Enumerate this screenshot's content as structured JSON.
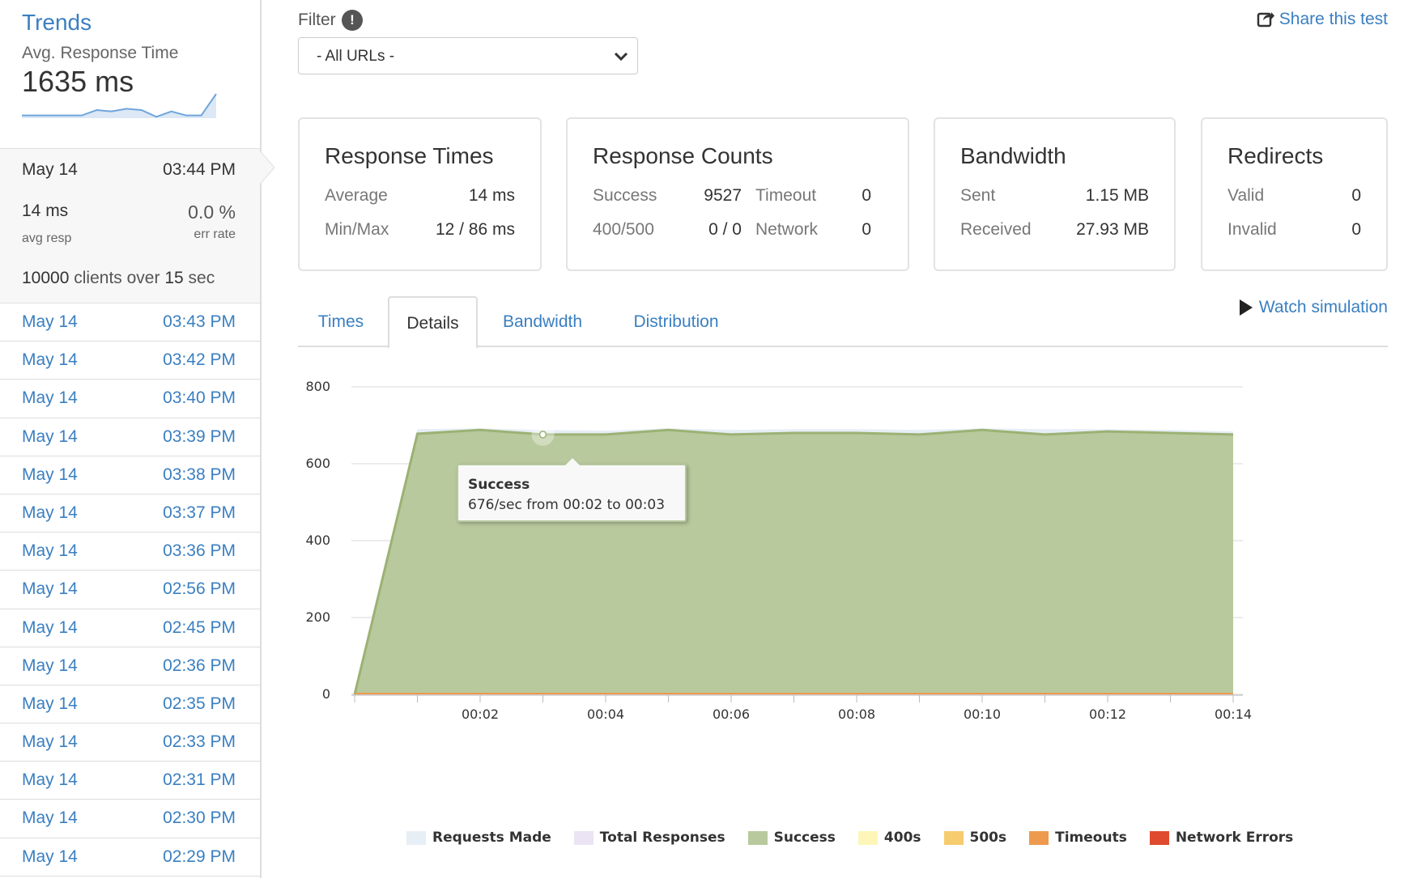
{
  "sidebar": {
    "title": "Trends",
    "metric_label": "Avg. Response Time",
    "metric_value": "1635 ms",
    "sparkline": [
      2,
      2,
      2,
      2,
      2,
      6,
      5,
      7,
      6,
      1,
      5,
      2,
      2,
      18
    ],
    "current": {
      "date": "May 14",
      "time": "03:44 PM",
      "avg_resp": "14 ms",
      "avg_resp_label": "avg resp",
      "err_rate": "0.0 %",
      "err_rate_label": "err rate",
      "clients": "10000",
      "clients_mid": "clients over",
      "duration": "15",
      "duration_unit": "sec"
    },
    "history": [
      {
        "date": "May 14",
        "time": "03:43 PM"
      },
      {
        "date": "May 14",
        "time": "03:42 PM"
      },
      {
        "date": "May 14",
        "time": "03:40 PM"
      },
      {
        "date": "May 14",
        "time": "03:39 PM"
      },
      {
        "date": "May 14",
        "time": "03:38 PM"
      },
      {
        "date": "May 14",
        "time": "03:37 PM"
      },
      {
        "date": "May 14",
        "time": "03:36 PM"
      },
      {
        "date": "May 14",
        "time": "02:56 PM"
      },
      {
        "date": "May 14",
        "time": "02:45 PM"
      },
      {
        "date": "May 14",
        "time": "02:36 PM"
      },
      {
        "date": "May 14",
        "time": "02:35 PM"
      },
      {
        "date": "May 14",
        "time": "02:33 PM"
      },
      {
        "date": "May 14",
        "time": "02:31 PM"
      },
      {
        "date": "May 14",
        "time": "02:30 PM"
      },
      {
        "date": "May 14",
        "time": "02:29 PM"
      }
    ]
  },
  "header": {
    "filter_label": "Filter",
    "filter_info": "!",
    "url_select_value": "- All URLs -",
    "share_label": "Share this test"
  },
  "cards": {
    "response_times": {
      "title": "Response Times",
      "average_label": "Average",
      "average_value": "14 ms",
      "minmax_label": "Min/Max",
      "minmax_value": "12 / 86 ms"
    },
    "response_counts": {
      "title": "Response Counts",
      "success_label": "Success",
      "success_value": "9527",
      "timeout_label": "Timeout",
      "timeout_value": "0",
      "e400_label": "400/500",
      "e400_value": "0 / 0",
      "network_label": "Network",
      "network_value": "0"
    },
    "bandwidth": {
      "title": "Bandwidth",
      "sent_label": "Sent",
      "sent_value": "1.15 MB",
      "received_label": "Received",
      "received_value": "27.93 MB"
    },
    "redirects": {
      "title": "Redirects",
      "valid_label": "Valid",
      "valid_value": "0",
      "invalid_label": "Invalid",
      "invalid_value": "0"
    }
  },
  "tabs": {
    "items": [
      "Times",
      "Details",
      "Bandwidth",
      "Distribution"
    ],
    "active": "Details",
    "watch_label": "Watch simulation"
  },
  "tooltip": {
    "title": "Success",
    "body": "676/sec from 00:02 to 00:03"
  },
  "colors": {
    "link": "#3a7fc1",
    "success": "#b8c99d",
    "success_line": "#9bb274",
    "requests": "#e6eef6",
    "responses": "#ebe4f4",
    "c400": "#fdf6b8",
    "c500": "#f6cc6f",
    "timeouts": "#ee9a4e",
    "network": "#e04a2e"
  },
  "chart_data": {
    "type": "area",
    "x": [
      "00:00",
      "00:01",
      "00:02",
      "00:03",
      "00:04",
      "00:05",
      "00:06",
      "00:07",
      "00:08",
      "00:09",
      "00:10",
      "00:11",
      "00:12",
      "00:13",
      "00:14"
    ],
    "x_tick_labels": [
      "00:02",
      "00:04",
      "00:06",
      "00:08",
      "00:10",
      "00:12",
      "00:14"
    ],
    "y_ticks": [
      0,
      200,
      400,
      600,
      800
    ],
    "ylim": [
      0,
      800
    ],
    "series": [
      {
        "name": "Requests Made",
        "color": "#e6eef6",
        "values": [
          0,
          690,
          692,
          688,
          686,
          692,
          688,
          690,
          690,
          688,
          692,
          690,
          690,
          688,
          684
        ]
      },
      {
        "name": "Total Responses",
        "color": "#ebe4f4",
        "values": [
          0,
          678,
          688,
          678,
          676,
          688,
          676,
          680,
          680,
          676,
          688,
          676,
          684,
          680,
          676
        ]
      },
      {
        "name": "Success",
        "color": "#b8c99d",
        "values": [
          0,
          678,
          688,
          676,
          676,
          688,
          676,
          680,
          680,
          676,
          688,
          676,
          684,
          680,
          676
        ]
      },
      {
        "name": "400s",
        "color": "#fdf6b8",
        "values": [
          0,
          0,
          0,
          0,
          0,
          0,
          0,
          0,
          0,
          0,
          0,
          0,
          0,
          0,
          0
        ]
      },
      {
        "name": "500s",
        "color": "#f6cc6f",
        "values": [
          0,
          0,
          0,
          0,
          0,
          0,
          0,
          0,
          0,
          0,
          0,
          0,
          0,
          0,
          0
        ]
      },
      {
        "name": "Timeouts",
        "color": "#ee9a4e",
        "values": [
          0,
          0,
          0,
          0,
          0,
          0,
          0,
          0,
          0,
          0,
          0,
          0,
          0,
          0,
          0
        ]
      },
      {
        "name": "Network Errors",
        "color": "#e04a2e",
        "values": [
          0,
          0,
          0,
          0,
          0,
          0,
          0,
          0,
          0,
          0,
          0,
          0,
          0,
          0,
          0
        ]
      }
    ],
    "legend_position": "bottom",
    "grid": true
  }
}
